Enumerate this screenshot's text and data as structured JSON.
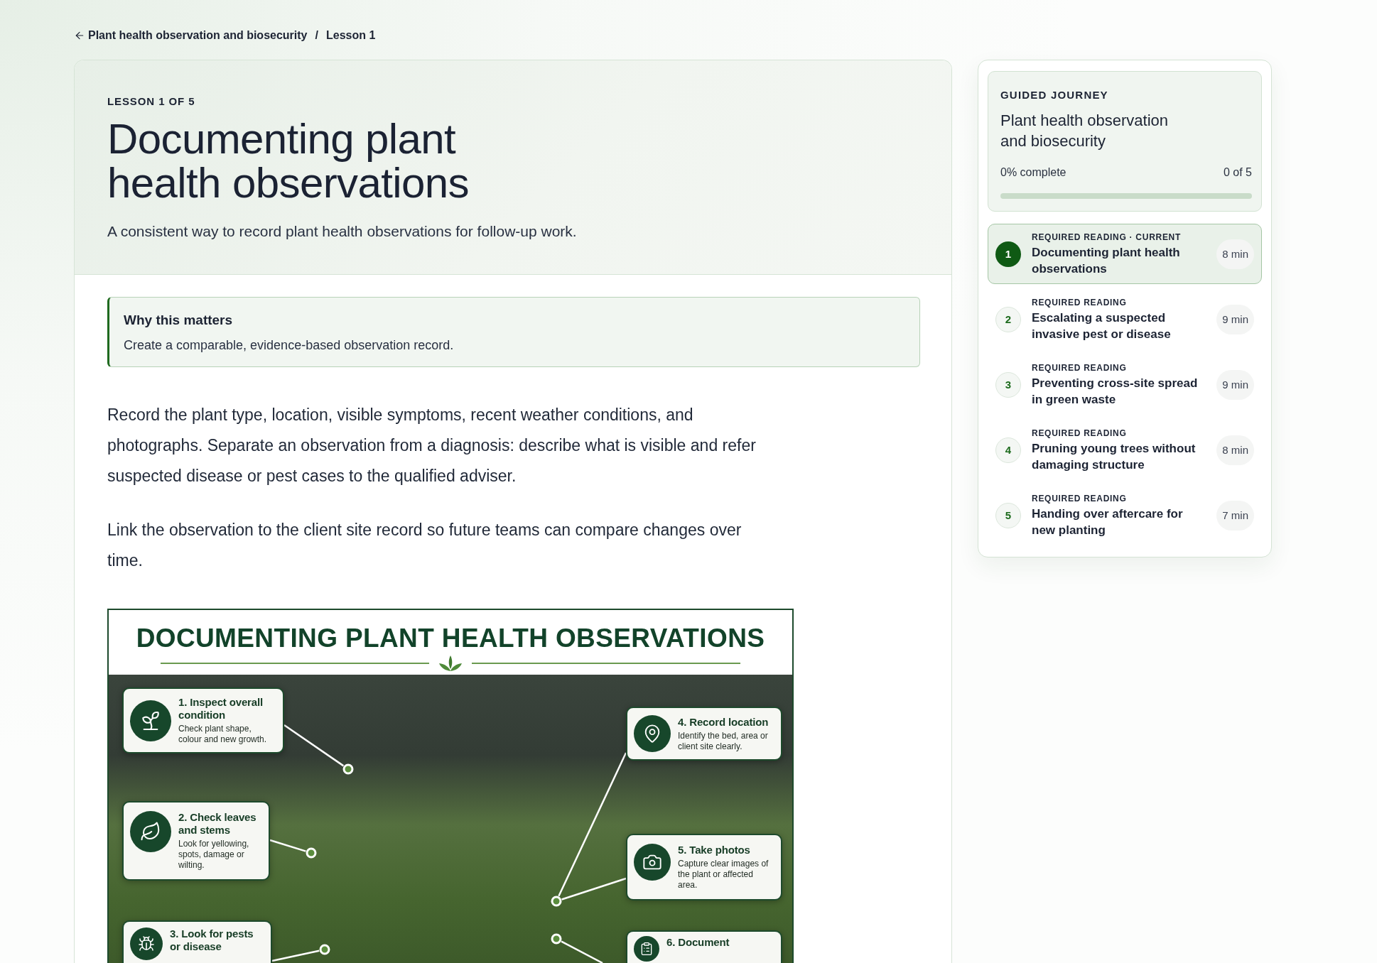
{
  "breadcrumb": {
    "parent": "Plant health observation and biosecurity",
    "separator": "/",
    "current": "Lesson 1"
  },
  "lesson": {
    "eyebrow": "LESSON 1 OF 5",
    "title": "Documenting plant health observations",
    "subtitle": "A consistent way to record plant health observations for follow-up work."
  },
  "callout": {
    "title": "Why this matters",
    "text": "Create a comparable, evidence-based observation record."
  },
  "paragraphs": [
    "Record the plant type, location, visible symptoms, recent weather conditions, and photographs. Separate an observation from a diagnosis: describe what is visible and refer suspected disease or pest cases to the qualified adviser.",
    "Link the observation to the client site record so future teams can compare changes over time."
  ],
  "infographic": {
    "title": "DOCUMENTING PLANT HEALTH OBSERVATIONS",
    "steps": [
      {
        "title": "1. Inspect overall condition",
        "text": "Check plant shape, colour and new growth."
      },
      {
        "title": "2. Check leaves and stems",
        "text": "Look for yellowing, spots, damage or wilting."
      },
      {
        "title": "3. Look for pests or disease"
      },
      {
        "title": "4. Record location",
        "text": "Identify the bed, area or client site clearly."
      },
      {
        "title": "5. Take photos",
        "text": "Capture clear images of the plant or affected area."
      },
      {
        "title": "6. Document"
      }
    ]
  },
  "sidebar": {
    "eyebrow": "GUIDED JOURNEY",
    "title": "Plant health observation and biosecurity",
    "progress": {
      "label": "0% complete",
      "count": "0 of 5"
    },
    "lessons": [
      {
        "number": "1",
        "label": "REQUIRED READING · CURRENT",
        "title": "Documenting plant health observations",
        "duration": "8 min",
        "selected": true
      },
      {
        "number": "2",
        "label": "REQUIRED READING",
        "title": "Escalating a suspected invasive pest or disease",
        "duration": "9 min",
        "selected": false
      },
      {
        "number": "3",
        "label": "REQUIRED READING",
        "title": "Preventing cross-site spread in green waste",
        "duration": "9 min",
        "selected": false
      },
      {
        "number": "4",
        "label": "REQUIRED READING",
        "title": "Pruning young trees without damaging structure",
        "duration": "8 min",
        "selected": false
      },
      {
        "number": "5",
        "label": "REQUIRED READING",
        "title": "Handing over aftercare for new planting",
        "duration": "7 min",
        "selected": false
      }
    ]
  }
}
